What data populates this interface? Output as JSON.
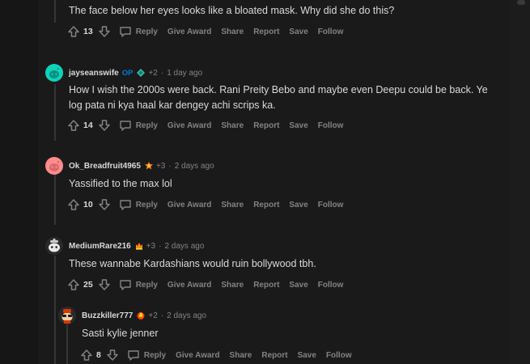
{
  "comments": [
    {
      "body": "The face below her eyes looks like a bloated mask. Why did she do this?",
      "score": "13"
    },
    {
      "username": "jayseanswife",
      "op_label": "OP",
      "karma": "+2",
      "time": "1 day ago",
      "body": "How I wish the 2000s were back. Rani Preity Bebo and maybe even Deepu could be back. Ye log pata ni kya haal kar dengey achi scrips ka.",
      "score": "14"
    },
    {
      "username": "Ok_Breadfruit4965",
      "karma": "+3",
      "time": "2 days ago",
      "body": "Yassified to the max lol",
      "score": "10"
    },
    {
      "username": "MediumRare216",
      "karma": "+3",
      "time": "2 days ago",
      "body": "These wannabe Kardashians would ruin bollywood tbh.",
      "score": "25"
    },
    {
      "username": "Buzzkiller777",
      "karma": "+2",
      "time": "2 days ago",
      "body": "Sasti kylie jenner",
      "score": "8"
    }
  ],
  "actions": {
    "reply": "Reply",
    "give_award": "Give Award",
    "share": "Share",
    "report": "Report",
    "save": "Save",
    "follow": "Follow"
  },
  "separator": "·",
  "colors": {
    "background": "#1a1a1b",
    "text": "#d7dadc",
    "muted": "#818384",
    "op_blue": "#0079d3",
    "avatar_teal": "#0dd3bb",
    "avatar_pink": "#ff8b8b"
  },
  "icons": [
    "upvote-icon",
    "downvote-icon",
    "comment-icon",
    "award-flair-icon",
    "snoo-avatar-icon"
  ]
}
